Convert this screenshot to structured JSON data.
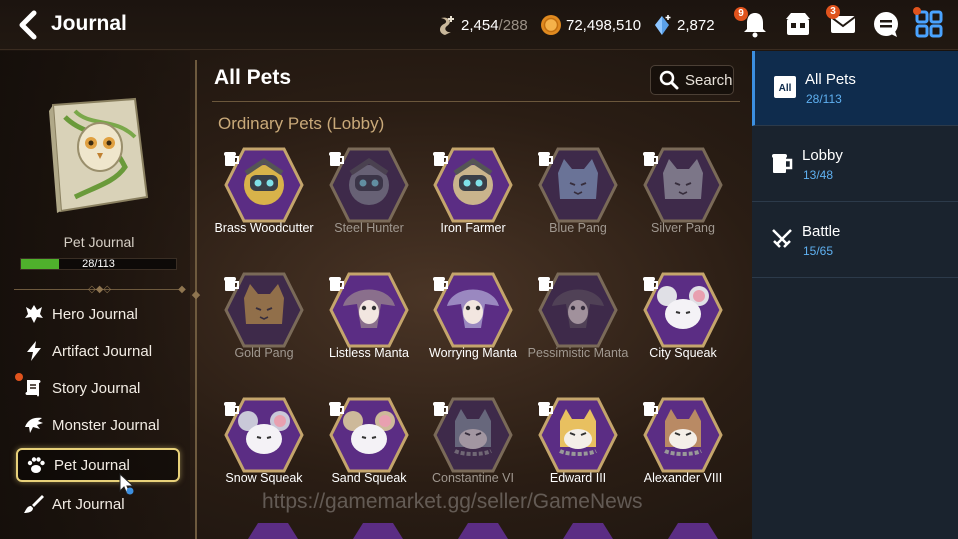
{
  "header": {
    "title": "Journal",
    "stamina_value": "2,454",
    "stamina_max": "/288",
    "gold": "72,498,510",
    "crystals": "2,872",
    "notifications_badge": "9",
    "mail_badge": "3"
  },
  "left_panel": {
    "pet_journal_label": "Pet Journal",
    "progress_text": "28/113",
    "progress_fraction": 0.248,
    "nav": [
      {
        "label": "Hero Journal",
        "icon": "hero-icon"
      },
      {
        "label": "Artifact Journal",
        "icon": "lightning-icon"
      },
      {
        "label": "Story Journal",
        "icon": "scroll-icon"
      },
      {
        "label": "Monster Journal",
        "icon": "dragon-icon"
      },
      {
        "label": "Pet Journal",
        "icon": "paw-icon"
      },
      {
        "label": "Art Journal",
        "icon": "brush-icon"
      }
    ]
  },
  "main": {
    "title": "All Pets",
    "search_label": "Search",
    "section_title": "Ordinary Pets (Lobby)",
    "pets": [
      {
        "name": "Brass Woodcutter",
        "owned": true,
        "kind": "robot",
        "tint": "#d8b34a"
      },
      {
        "name": "Steel Hunter",
        "owned": false,
        "kind": "robot",
        "tint": "#8a8f99"
      },
      {
        "name": "Iron Farmer",
        "owned": true,
        "kind": "robot",
        "tint": "#c9b48c"
      },
      {
        "name": "Blue Pang",
        "owned": false,
        "kind": "cat",
        "tint": "#8fb0d6"
      },
      {
        "name": "Silver Pang",
        "owned": false,
        "kind": "cat",
        "tint": "#b0b4bb"
      },
      {
        "name": "Gold Pang",
        "owned": false,
        "kind": "cat",
        "tint": "#d6a94a"
      },
      {
        "name": "Listless Manta",
        "owned": true,
        "kind": "manta",
        "tint": "#8a6f8c"
      },
      {
        "name": "Worrying Manta",
        "owned": true,
        "kind": "manta",
        "tint": "#9a88c0"
      },
      {
        "name": "Pessimistic Manta",
        "owned": false,
        "kind": "manta",
        "tint": "#5f5560"
      },
      {
        "name": "City Squeak",
        "owned": true,
        "kind": "mouse",
        "tint": "#e0e0e6"
      },
      {
        "name": "Snow Squeak",
        "owned": true,
        "kind": "mouse",
        "tint": "#c9c8d8"
      },
      {
        "name": "Sand Squeak",
        "owned": true,
        "kind": "mouse",
        "tint": "#cdb99a"
      },
      {
        "name": "Constantine VI",
        "owned": false,
        "kind": "dogcat",
        "tint": "#8a9aa6"
      },
      {
        "name": "Edward III",
        "owned": true,
        "kind": "dogcat",
        "tint": "#e8c060"
      },
      {
        "name": "Alexander VIII",
        "owned": true,
        "kind": "dogcat",
        "tint": "#b98a64"
      }
    ]
  },
  "right_panel": {
    "tabs": [
      {
        "label": "All Pets",
        "count": "28/113",
        "icon": "all-icon"
      },
      {
        "label": "Lobby",
        "count": "13/48",
        "icon": "mug-icon"
      },
      {
        "label": "Battle",
        "count": "15/65",
        "icon": "crossed-swords-icon"
      }
    ]
  },
  "watermark": "https://gamemarket.gg/seller/GameNews",
  "colors": {
    "accent_blue": "#3c8fe0",
    "count_blue": "#5fb0f0",
    "section_gold": "#c9a979",
    "progress_green": "#4fb12c",
    "badge_orange": "#e0531d",
    "hex_purple": "#5b2d84"
  }
}
